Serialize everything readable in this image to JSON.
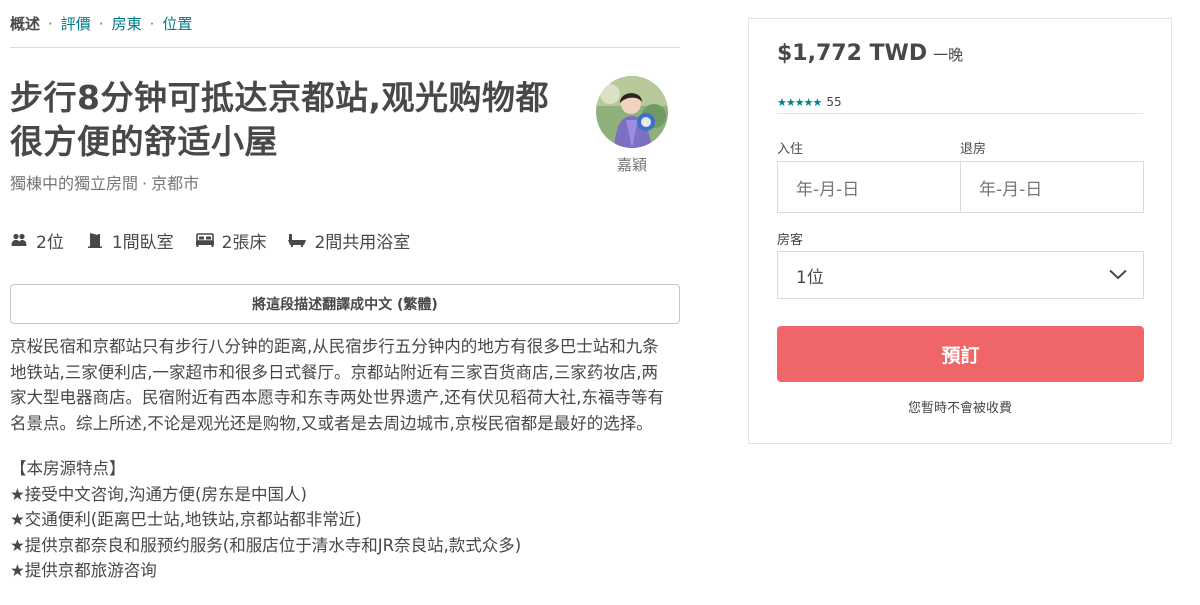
{
  "subnav": {
    "items": [
      "概述",
      "評價",
      "房東",
      "位置"
    ],
    "separator": "·"
  },
  "listing": {
    "title": "步行8分钟可抵达京都站,观光购物都很方便的舒适小屋",
    "room_type": "獨棟中的獨立房間",
    "location_sep": "·",
    "location": "京都市"
  },
  "host": {
    "name": "嘉穎"
  },
  "amenities": {
    "guests": "2位",
    "bedrooms": "1間臥室",
    "beds": "2張床",
    "baths": "2間共用浴室"
  },
  "translate_button": "將這段描述翻譯成中文 (繁體)",
  "description": "京桜民宿和京都站只有步行八分钟的距离,从民宿步行五分钟内的地方有很多巴士站和九条地铁站,三家便利店,一家超市和很多日式餐厅。京都站附近有三家百货商店,三家药妆店,两家大型电器商店。民宿附近有西本愿寺和东寺两处世界遗产,还有伏见稻荷大社,东福寺等有名景点。综上所述,不论是观光还是购物,又或者是去周边城市,京桜民宿都是最好的选择。",
  "features": {
    "heading": "【本房源特点】",
    "items": [
      "★接受中文咨询,沟通方便(房东是中国人)",
      "★交通便利(距离巴士站,地铁站,京都站都非常近)",
      "★提供京都奈良和服预约服务(和服店位于清水寺和JR奈良站,款式众多)",
      "★提供京都旅游咨询"
    ]
  },
  "booking": {
    "price": "$1,772 TWD",
    "per_night": "一晚",
    "stars": "★★★★★",
    "review_count": "55",
    "checkin_label": "入住",
    "checkout_label": "退房",
    "checkin_placeholder": "年-月-日",
    "checkout_placeholder": "年-月-日",
    "guests_label": "房客",
    "guests_value": "1位",
    "book_button": "預訂",
    "note": "您暫時不會被收費"
  },
  "colors": {
    "accent_teal": "#007a87",
    "star_teal": "#008489",
    "book_red": "#f06567",
    "text": "#484848",
    "muted": "#767676"
  }
}
